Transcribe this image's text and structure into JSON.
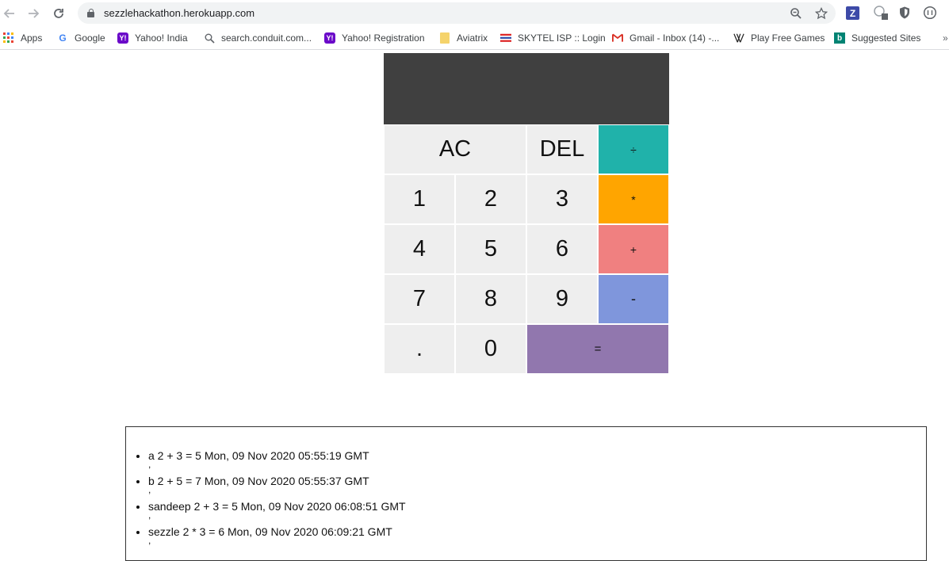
{
  "browser": {
    "url": "sezzlehackathon.herokuapp.com",
    "bookmarks": [
      {
        "label": "Apps",
        "icon": "apps-grid-icon"
      },
      {
        "label": "Google",
        "icon": "google-icon"
      },
      {
        "label": "Yahoo! India",
        "icon": "yahoo-icon"
      },
      {
        "label": "search.conduit.com...",
        "icon": "search-icon"
      },
      {
        "label": "Yahoo! Registration",
        "icon": "yahoo-icon"
      },
      {
        "label": "Aviatrix",
        "icon": "folder-icon"
      },
      {
        "label": "SKYTEL ISP :: Login",
        "icon": "skytel-icon"
      },
      {
        "label": "Gmail - Inbox (14) -...",
        "icon": "gmail-icon"
      },
      {
        "label": "Play Free Games",
        "icon": "games-icon"
      },
      {
        "label": "Suggested Sites",
        "icon": "bing-icon"
      }
    ],
    "more_bookmarks": "»"
  },
  "calculator": {
    "display_value": "",
    "keys": {
      "ac": "AC",
      "del": "DEL",
      "divide": "÷",
      "multiply": "*",
      "add": "+",
      "subtract": "-",
      "equals": "=",
      "dot": ".",
      "d0": "0",
      "d1": "1",
      "d2": "2",
      "d3": "3",
      "d4": "4",
      "d5": "5",
      "d6": "6",
      "d7": "7",
      "d8": "8",
      "d9": "9"
    },
    "colors": {
      "display": "#404040",
      "number_key": "#eeeeee",
      "divide": "#20b2aa",
      "multiply": "#ffa500",
      "add": "#f08080",
      "subtract": "#7f96dc",
      "equals": "#9177ae"
    }
  },
  "history": {
    "entries": [
      {
        "text": "a 2 + 3 = 5 Mon, 09 Nov 2020 05:55:19 GMT",
        "separator": ","
      },
      {
        "text": "b 2 + 5 = 7 Mon, 09 Nov 2020 05:55:37 GMT",
        "separator": ","
      },
      {
        "text": "sandeep 2 + 3 = 5 Mon, 09 Nov 2020 06:08:51 GMT",
        "separator": ","
      },
      {
        "text": "sezzle 2 * 3 = 6 Mon, 09 Nov 2020 06:09:21 GMT",
        "separator": ","
      }
    ]
  }
}
